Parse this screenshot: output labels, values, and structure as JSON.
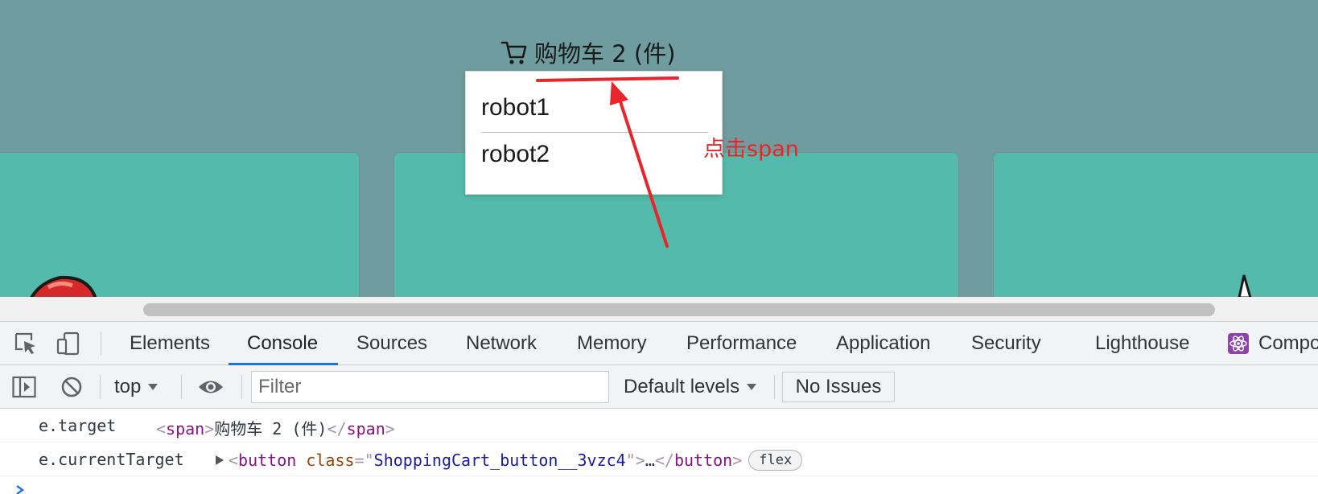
{
  "page": {
    "cart_label": "购物车 2 (件)",
    "cart_items": [
      "robot1",
      "robot2"
    ],
    "annotation": "点击span"
  },
  "devtools": {
    "tabs": [
      "Elements",
      "Console",
      "Sources",
      "Network",
      "Memory",
      "Performance",
      "Application",
      "Security",
      "Lighthouse",
      "Compo"
    ],
    "active_tab": "Console",
    "toolbar": {
      "context": "top",
      "filter_placeholder": "Filter",
      "levels": "Default levels",
      "issues": "No Issues"
    },
    "console": {
      "rows": [
        {
          "key": "e.target",
          "tag_open": "span",
          "text": "购物车 2 (件)",
          "tag_close": "span"
        },
        {
          "key": "e.currentTarget",
          "tag_open": "button",
          "attr_name": "class",
          "attr_value": "ShoppingCart_button__3vzc4",
          "ellipsis": "…",
          "tag_close": "button",
          "badge": "flex"
        }
      ]
    }
  },
  "colors": {
    "page_background": "#6f9c9e",
    "card": "#54baab",
    "annotation_red": "#e8252a",
    "active_tab_underline": "#1a73e8"
  },
  "icons": [
    "cart-icon",
    "inspect-icon",
    "device-toggle-icon",
    "sidebar-icon",
    "clear-icon",
    "dropdown-arrow-icon",
    "eye-icon",
    "react-icon",
    "prompt-chevron-icon"
  ]
}
